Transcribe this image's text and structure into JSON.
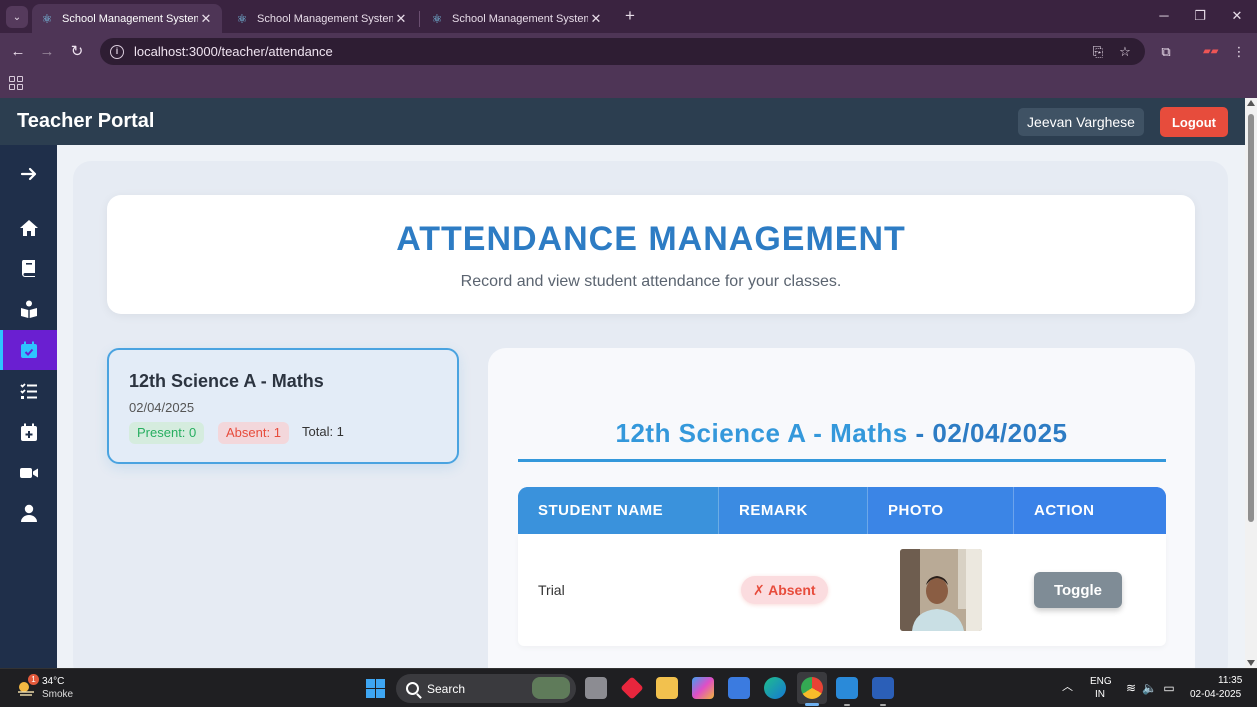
{
  "browser": {
    "tabs": [
      {
        "title": "School Management System",
        "active": true
      },
      {
        "title": "School Management System",
        "active": false
      },
      {
        "title": "School Management System",
        "active": false
      }
    ],
    "url": "localhost:3000/teacher/attendance"
  },
  "topnav": {
    "brand": "Teacher Portal",
    "user_name": "Jeevan Varghese",
    "logout_label": "Logout"
  },
  "sidebar": {
    "items": [
      {
        "icon": "arrow-right-icon"
      },
      {
        "icon": "home-icon"
      },
      {
        "icon": "book-icon"
      },
      {
        "icon": "reader-icon"
      },
      {
        "icon": "calendar-check-icon",
        "active": true
      },
      {
        "icon": "task-list-icon"
      },
      {
        "icon": "calendar-plus-icon"
      },
      {
        "icon": "video-icon"
      },
      {
        "icon": "user-icon"
      }
    ]
  },
  "header": {
    "title": "ATTENDANCE MANAGEMENT",
    "subtitle": "Record and view student attendance for your classes."
  },
  "class_card": {
    "title": "12th Science A - Maths",
    "date": "02/04/2025",
    "present": "Present: 0",
    "absent": "Absent: 1",
    "total": "Total: 1"
  },
  "detail": {
    "title_class": "12th Science A - Maths",
    "title_sep": " - ",
    "title_date": "02/04/2025",
    "columns": [
      "STUDENT NAME",
      "REMARK",
      "PHOTO",
      "ACTION"
    ],
    "rows": [
      {
        "name": "Trial",
        "remark": "✗ Absent",
        "action": "Toggle"
      }
    ]
  },
  "taskbar": {
    "weather_temp": "34°C",
    "weather_desc": "Smoke",
    "weather_badge": "1",
    "search_label": "Search",
    "lang_line1": "ENG",
    "lang_line2": "IN",
    "time": "11:35",
    "date": "02-04-2025"
  },
  "colors": {
    "nav_bg": "#2c3e50",
    "sidebar_bg": "#1f2f4a",
    "sidebar_active": "#6a1fd1",
    "accent_blue": "#3498db",
    "logout_red": "#e74c3c",
    "present_green": "#27ae60"
  }
}
